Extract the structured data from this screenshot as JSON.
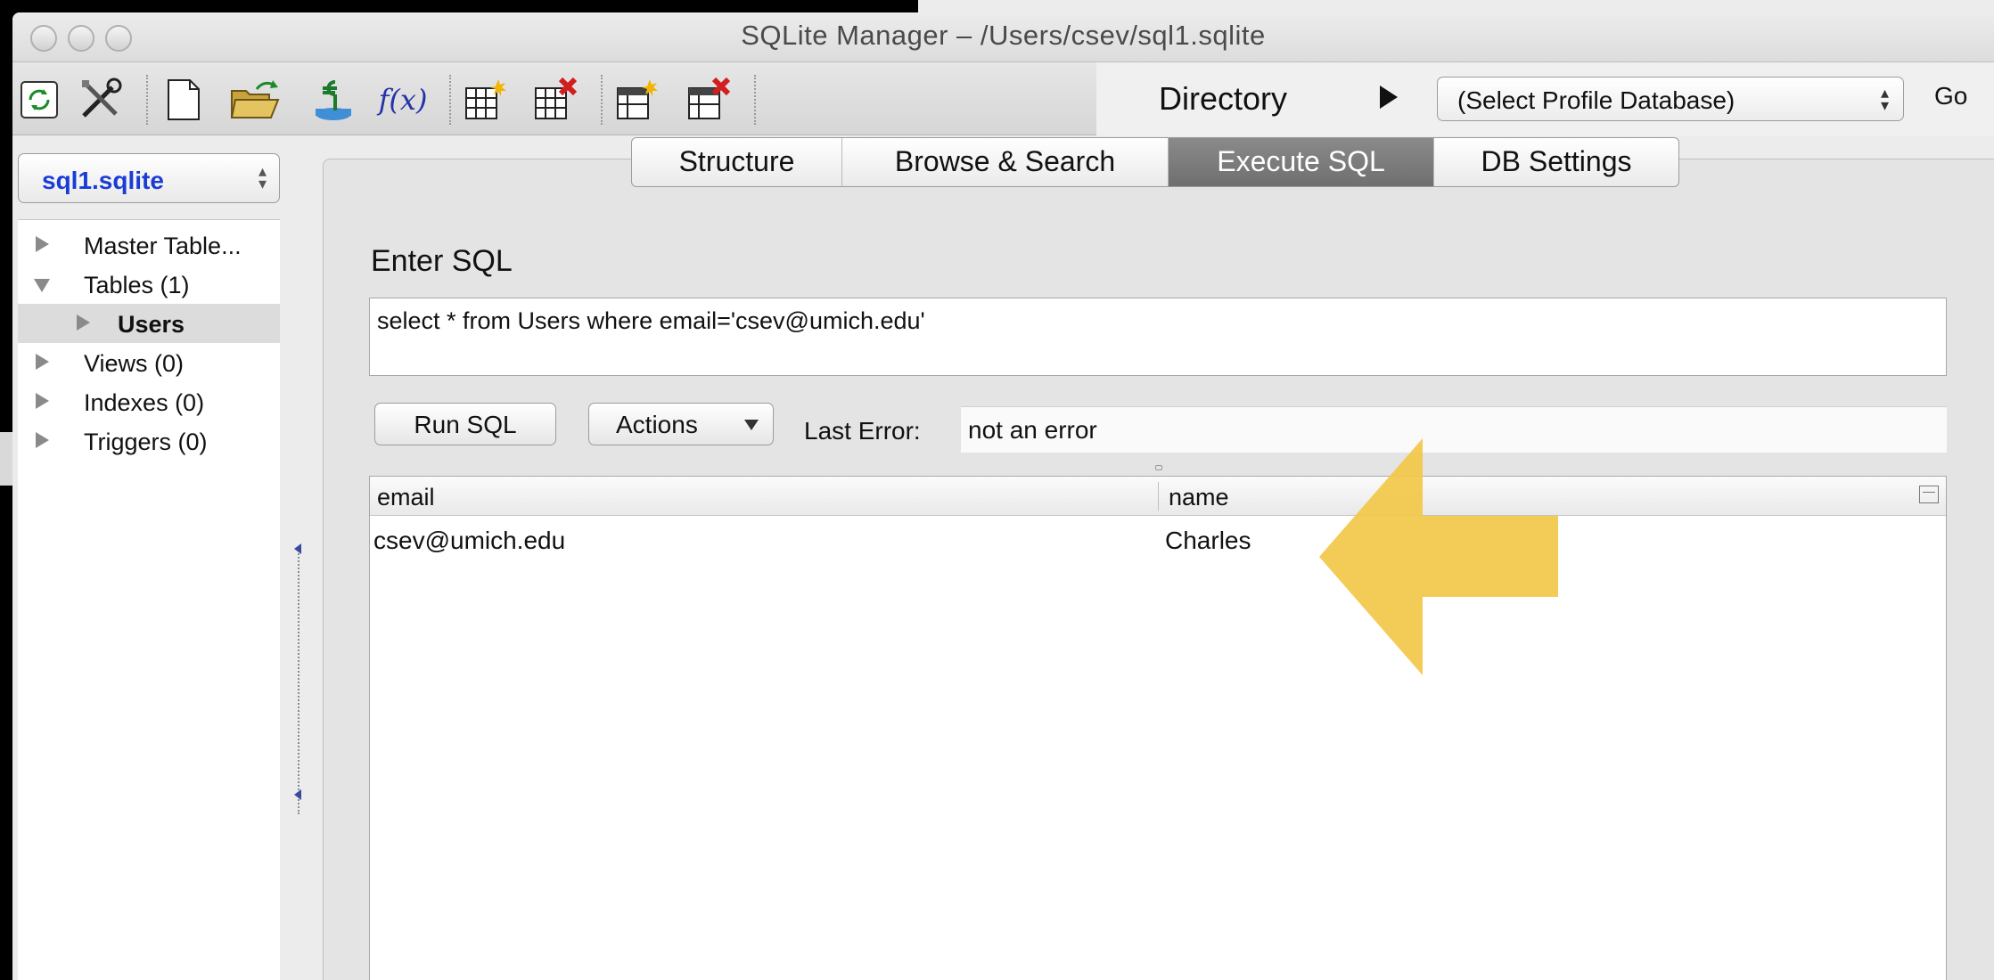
{
  "window": {
    "title": "SQLite Manager – /Users/csev/sql1.sqlite"
  },
  "toolbar": {
    "icons": [
      "reload-icon",
      "tools-icon",
      "new-database-icon",
      "open-database-icon",
      "connect-database-icon",
      "function-icon",
      "create-table-icon",
      "drop-table-icon",
      "create-index-icon",
      "drop-index-icon"
    ],
    "function_label": "f(x)",
    "directory_label": "Directory",
    "profile_select": "(Select Profile Database)",
    "go_label": "Go"
  },
  "sidebar": {
    "database": "sql1.sqlite",
    "tree": [
      {
        "label": "Master Table...",
        "expanded": false,
        "child": false
      },
      {
        "label": "Tables (1)",
        "expanded": true,
        "child": false
      },
      {
        "label": "Users",
        "expanded": false,
        "child": true,
        "selected": true
      },
      {
        "label": "Views (0)",
        "expanded": false,
        "child": false
      },
      {
        "label": "Indexes (0)",
        "expanded": false,
        "child": false
      },
      {
        "label": "Triggers (0)",
        "expanded": false,
        "child": false
      }
    ]
  },
  "tabs": [
    {
      "label": "Structure",
      "active": false
    },
    {
      "label": "Browse & Search",
      "active": false
    },
    {
      "label": "Execute SQL",
      "active": true
    },
    {
      "label": "DB Settings",
      "active": false
    }
  ],
  "sql": {
    "heading": "Enter SQL",
    "query": "select * from Users where email='csev@umich.edu'",
    "run_label": "Run SQL",
    "actions_label": "Actions",
    "last_error_label": "Last Error:",
    "last_error_value": "not an error"
  },
  "results": {
    "columns": [
      "email",
      "name"
    ],
    "rows": [
      [
        "csev@umich.edu",
        "Charles"
      ]
    ]
  },
  "colors": {
    "annotation_arrow": "#f3c84a",
    "active_tab": "#7a7a7a",
    "db_name": "#1a3cd6"
  }
}
